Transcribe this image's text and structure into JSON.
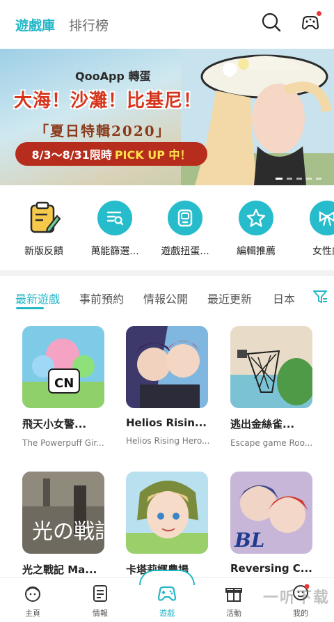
{
  "header": {
    "tabs": [
      {
        "label": "遊戲庫",
        "active": true
      },
      {
        "label": "排行榜",
        "active": false
      }
    ],
    "icons": [
      "search-icon",
      "gamepad-egg-icon"
    ]
  },
  "banner": {
    "logo": "QooApp 轉蛋",
    "title": "大海！沙灘！比基尼！",
    "subtitle": "「夏日特輯2020」",
    "date_text": "8/3～8/31限時",
    "pick_text": "PICK UP 中！"
  },
  "quick_actions": [
    {
      "label": "新版反饋",
      "icon": "clipboard-pencil-icon"
    },
    {
      "label": "萬能篩選...",
      "icon": "filter-list-icon"
    },
    {
      "label": "遊戲扭蛋...",
      "icon": "gacha-machine-icon"
    },
    {
      "label": "編輯推薦",
      "icon": "star-icon"
    },
    {
      "label": "女性向",
      "icon": "ribbon-icon"
    }
  ],
  "category_tabs": [
    "最新遊戲",
    "事前預約",
    "情報公開",
    "最近更新",
    "日本"
  ],
  "games": [
    {
      "title": "飛天小女警...",
      "subtitle": "The Powerpuff Gir..."
    },
    {
      "title": "Helios Risin...",
      "subtitle": "Helios Rising Hero..."
    },
    {
      "title": "逃出金絲雀...",
      "subtitle": "Escape game Roo..."
    },
    {
      "title": "光之戰記 Ma...",
      "subtitle": ""
    },
    {
      "title": "卡塔莉娜農場",
      "subtitle": ""
    },
    {
      "title": "Reversing C...",
      "subtitle": ""
    }
  ],
  "bottom_nav": [
    {
      "label": "主頁",
      "icon": "home-face-icon"
    },
    {
      "label": "情報",
      "icon": "news-icon"
    },
    {
      "label": "遊戲",
      "icon": "gamepad-icon",
      "active": true
    },
    {
      "label": "活動",
      "icon": "gift-icon"
    },
    {
      "label": "我的",
      "icon": "profile-icon"
    }
  ],
  "watermark": "一听下载",
  "colors": {
    "accent": "#25b7c8",
    "notification": "#e53935",
    "banner_red": "#b72d1d"
  }
}
